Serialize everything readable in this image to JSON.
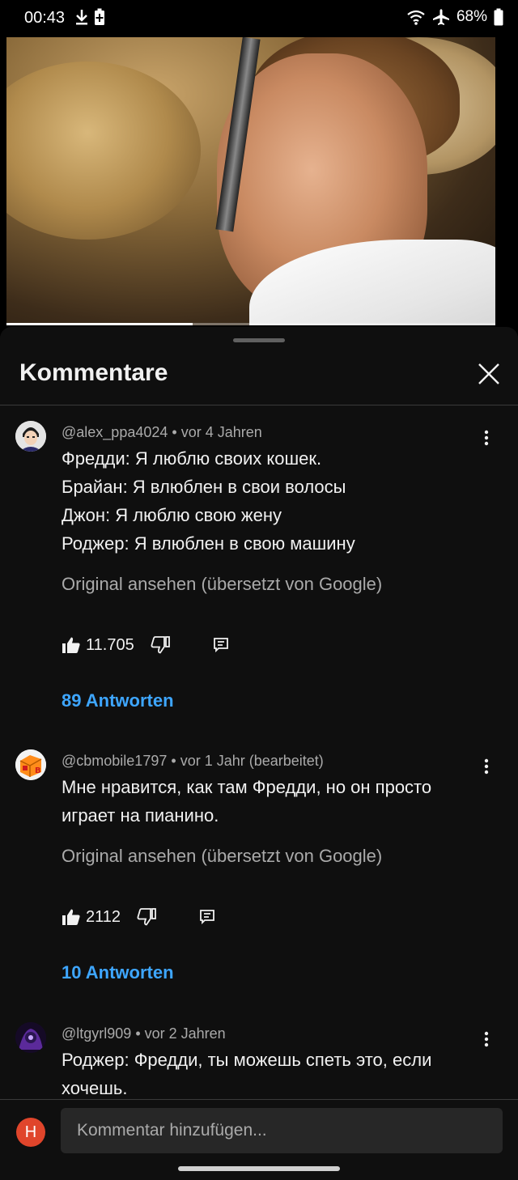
{
  "status_bar": {
    "time": "00:43",
    "battery": "68%",
    "icons": [
      "download-icon",
      "battery-saver-icon",
      "wifi-icon",
      "airplane-icon",
      "battery-icon"
    ]
  },
  "video": {
    "progress_fraction": 0.38
  },
  "panel": {
    "title": "Kommentare"
  },
  "comments": [
    {
      "author": "@alex_ppa4024",
      "time": "vor 4 Jahren",
      "lines": [
        "Фредди: Я люблю своих кошек.",
        "Брайан: Я влюблен в свои волосы",
        "Джон: Я люблю свою жену",
        "Роджер: Я влюблен в свою машину"
      ],
      "translate_note": "Original ansehen (übersetzt von Google)",
      "likes": "11.705",
      "replies": "89 Antworten"
    },
    {
      "author": "@cbmobile1797",
      "time": "vor 1 Jahr (bearbeitet)",
      "lines": [
        "Мне нравится, как там Фредди, но он просто",
        "играет на пианино."
      ],
      "translate_note": "Original ansehen (übersetzt von Google)",
      "likes": "2112",
      "replies": "10 Antworten"
    },
    {
      "author": "@ltgyrl909",
      "time": "vor 2 Jahren",
      "lines": [
        "Роджер: Фредди, ты можешь спеть это, если",
        "хочешь."
      ]
    }
  ],
  "footer": {
    "user_initial": "H",
    "input_placeholder": "Kommentar hinzufügen..."
  },
  "colors": {
    "background": "#0f0f0f",
    "link": "#3ea6ff",
    "secondary_text": "#aaaaaa",
    "user_avatar": "#e0452b"
  }
}
